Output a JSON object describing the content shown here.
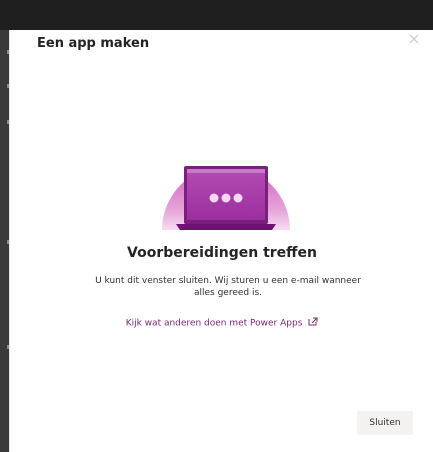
{
  "dialog": {
    "title": "Een app maken",
    "close_icon": "close-icon",
    "illustration": "laptop-loading-illustration",
    "heading": "Voorbereidingen treffen",
    "description": "U kunt dit venster sluiten. Wij sturen u een e-mail wanneer alles gereed is.",
    "link_label": "Kijk wat anderen doen met Power Apps",
    "link_icon": "external-link-icon",
    "close_button_label": "Sluiten"
  },
  "colors": {
    "accent": "#742774",
    "illustration_circle": "#d46fc2",
    "illustration_screen": "#a63aa8",
    "button_bg": "#f3f2f1",
    "topbar": "#1f1f1f"
  }
}
